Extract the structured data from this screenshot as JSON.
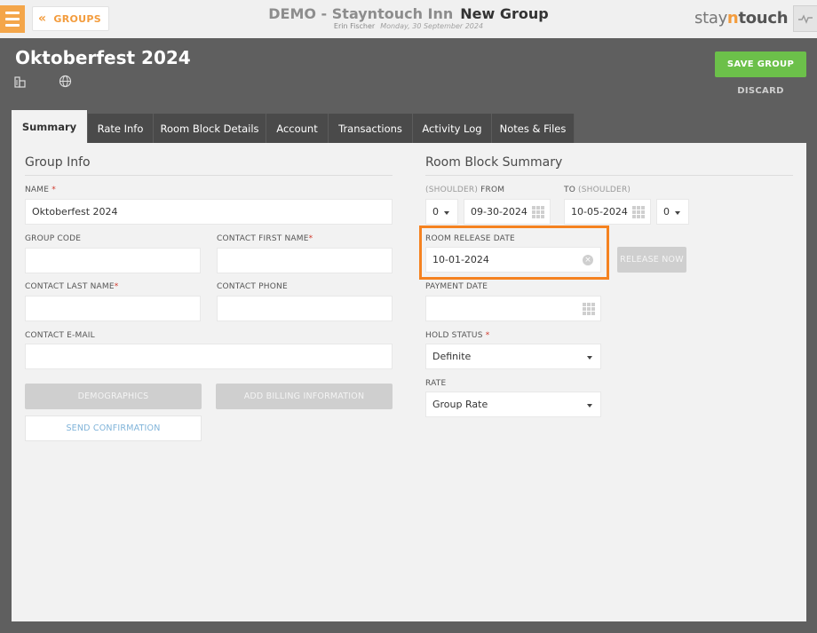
{
  "topbar": {
    "back_label": "GROUPS",
    "title": "DEMO - Stayntouch Inn",
    "page_title": "New Group",
    "user": "Erin Fischer",
    "date": "Monday, 30 September 2024",
    "logo_prefix": "stay",
    "logo_accent": "n",
    "logo_suffix": "touch"
  },
  "header": {
    "group_name": "Oktoberfest 2024",
    "save_label": "SAVE GROUP",
    "discard_label": "DISCARD"
  },
  "tabs": [
    {
      "label": "Summary",
      "active": true
    },
    {
      "label": "Rate Info"
    },
    {
      "label": "Room Block Details"
    },
    {
      "label": "Account"
    },
    {
      "label": "Transactions"
    },
    {
      "label": "Activity Log"
    },
    {
      "label": "Notes & Files"
    }
  ],
  "group_info": {
    "title": "Group Info",
    "name_label": "NAME",
    "name_value": "Oktoberfest 2024",
    "group_code_label": "GROUP CODE",
    "group_code_value": "",
    "contact_first_label": "CONTACT FIRST NAME",
    "contact_first_value": "",
    "contact_last_label": "CONTACT LAST NAME",
    "contact_last_value": "",
    "contact_phone_label": "CONTACT PHONE",
    "contact_phone_value": "",
    "contact_email_label": "CONTACT E-MAIL",
    "contact_email_value": "",
    "demographics_label": "DEMOGRAPHICS",
    "billing_label": "ADD BILLING INFORMATION",
    "send_confirmation_label": "SEND CONFIRMATION"
  },
  "room_block": {
    "title": "Room Block Summary",
    "from_shoulder": "(SHOULDER)",
    "from_label": "FROM",
    "to_label": "TO",
    "to_shoulder": "(SHOULDER)",
    "from_shoulder_value": "0",
    "from_date": "09-30-2024",
    "to_date": "10-05-2024",
    "to_shoulder_value": "0",
    "release_label": "ROOM RELEASE DATE",
    "release_date": "10-01-2024",
    "release_now_label": "RELEASE NOW",
    "payment_label": "PAYMENT DATE",
    "payment_value": "",
    "hold_label": "HOLD STATUS",
    "hold_value": "Definite",
    "rate_label": "RATE",
    "rate_value": "Group Rate"
  },
  "colors": {
    "accent": "#f39c3d",
    "save_green": "#6cc04a",
    "highlight": "#f58220",
    "required": "#d0382b"
  },
  "icons": [
    "menu-icon",
    "double-chevron-left-icon",
    "pulse-icon",
    "building-icon",
    "globe-icon",
    "calendar-icon",
    "clear-icon",
    "dropdown-caret-icon"
  ]
}
